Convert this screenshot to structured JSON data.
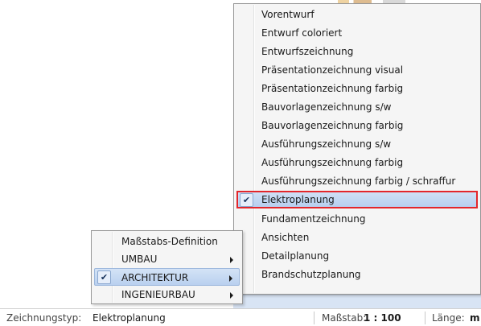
{
  "right_menu": {
    "items": [
      {
        "label": "Vorentwurf"
      },
      {
        "label": "Entwurf coloriert"
      },
      {
        "label": "Entwurfszeichnung"
      },
      {
        "label": "Präsentationzeichnung visual"
      },
      {
        "label": "Präsentationzeichnung farbig"
      },
      {
        "label": "Bauvorlagenzeichnung s/w"
      },
      {
        "label": "Bauvorlagenzeichnung farbig"
      },
      {
        "label": "Ausführungszeichnung  s/w"
      },
      {
        "label": "Ausführungszeichnung  farbig"
      },
      {
        "label": "Ausführungszeichnung  farbig / schraffur"
      },
      {
        "label": "Elektroplanung",
        "checked": true,
        "selected": true
      },
      {
        "label": "Fundamentzeichnung"
      },
      {
        "label": "Ansichten"
      },
      {
        "label": "Detailplanung"
      },
      {
        "label": "Brandschutzplanung"
      }
    ]
  },
  "left_menu": {
    "items": [
      {
        "label": "Maßstabs-Definition",
        "submenu": false
      },
      {
        "label": "UMBAU",
        "submenu": true
      },
      {
        "label": "ARCHITEKTUR",
        "submenu": true,
        "checked": true,
        "highlighted": true
      },
      {
        "label": "INGENIEURBAU",
        "submenu": true
      }
    ]
  },
  "status_bar": {
    "drawing_type_label": "Zeichnungstyp:",
    "drawing_type_value": "Elektroplanung",
    "scale_label": "Maßstab:",
    "scale_value": "1 : 100",
    "length_label": "Länge:",
    "length_value": "m"
  },
  "icons": {
    "check": "check-icon",
    "submenu_arrow": "submenu-arrow-icon"
  },
  "colors": {
    "selection_border": "#e3262b",
    "selection_fill": "#b7cfef",
    "menu_bg": "#f5f5f5"
  }
}
